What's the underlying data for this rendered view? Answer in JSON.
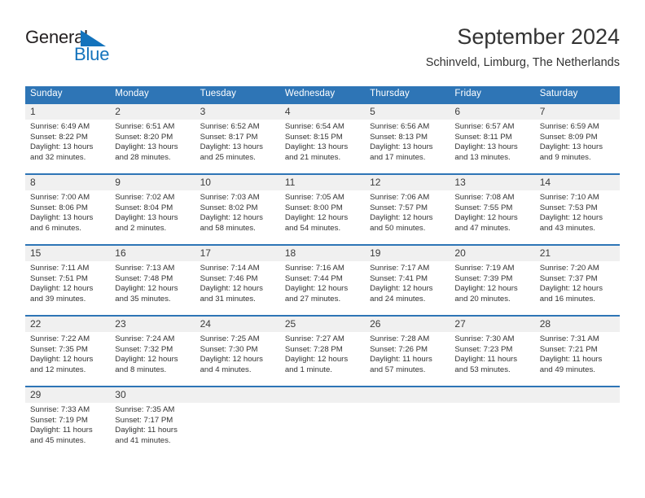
{
  "brand": {
    "name_part1": "General",
    "name_part2": "Blue",
    "triangle_color": "#1473bc",
    "text_color": "#231f20"
  },
  "header": {
    "title": "September 2024",
    "subtitle": "Schinveld, Limburg, The Netherlands"
  },
  "theme": {
    "header_bg": "#2e75b6",
    "header_text": "#ffffff",
    "daynum_bg": "#f0f0f0",
    "body_text": "#333333"
  },
  "weekdays": [
    {
      "label": "Sunday"
    },
    {
      "label": "Monday"
    },
    {
      "label": "Tuesday"
    },
    {
      "label": "Wednesday"
    },
    {
      "label": "Thursday"
    },
    {
      "label": "Friday"
    },
    {
      "label": "Saturday"
    }
  ],
  "weeks": [
    {
      "days": [
        {
          "num": "1",
          "sunrise": "Sunrise: 6:49 AM",
          "sunset": "Sunset: 8:22 PM",
          "daylight1": "Daylight: 13 hours",
          "daylight2": "and 32 minutes."
        },
        {
          "num": "2",
          "sunrise": "Sunrise: 6:51 AM",
          "sunset": "Sunset: 8:20 PM",
          "daylight1": "Daylight: 13 hours",
          "daylight2": "and 28 minutes."
        },
        {
          "num": "3",
          "sunrise": "Sunrise: 6:52 AM",
          "sunset": "Sunset: 8:17 PM",
          "daylight1": "Daylight: 13 hours",
          "daylight2": "and 25 minutes."
        },
        {
          "num": "4",
          "sunrise": "Sunrise: 6:54 AM",
          "sunset": "Sunset: 8:15 PM",
          "daylight1": "Daylight: 13 hours",
          "daylight2": "and 21 minutes."
        },
        {
          "num": "5",
          "sunrise": "Sunrise: 6:56 AM",
          "sunset": "Sunset: 8:13 PM",
          "daylight1": "Daylight: 13 hours",
          "daylight2": "and 17 minutes."
        },
        {
          "num": "6",
          "sunrise": "Sunrise: 6:57 AM",
          "sunset": "Sunset: 8:11 PM",
          "daylight1": "Daylight: 13 hours",
          "daylight2": "and 13 minutes."
        },
        {
          "num": "7",
          "sunrise": "Sunrise: 6:59 AM",
          "sunset": "Sunset: 8:09 PM",
          "daylight1": "Daylight: 13 hours",
          "daylight2": "and 9 minutes."
        }
      ]
    },
    {
      "days": [
        {
          "num": "8",
          "sunrise": "Sunrise: 7:00 AM",
          "sunset": "Sunset: 8:06 PM",
          "daylight1": "Daylight: 13 hours",
          "daylight2": "and 6 minutes."
        },
        {
          "num": "9",
          "sunrise": "Sunrise: 7:02 AM",
          "sunset": "Sunset: 8:04 PM",
          "daylight1": "Daylight: 13 hours",
          "daylight2": "and 2 minutes."
        },
        {
          "num": "10",
          "sunrise": "Sunrise: 7:03 AM",
          "sunset": "Sunset: 8:02 PM",
          "daylight1": "Daylight: 12 hours",
          "daylight2": "and 58 minutes."
        },
        {
          "num": "11",
          "sunrise": "Sunrise: 7:05 AM",
          "sunset": "Sunset: 8:00 PM",
          "daylight1": "Daylight: 12 hours",
          "daylight2": "and 54 minutes."
        },
        {
          "num": "12",
          "sunrise": "Sunrise: 7:06 AM",
          "sunset": "Sunset: 7:57 PM",
          "daylight1": "Daylight: 12 hours",
          "daylight2": "and 50 minutes."
        },
        {
          "num": "13",
          "sunrise": "Sunrise: 7:08 AM",
          "sunset": "Sunset: 7:55 PM",
          "daylight1": "Daylight: 12 hours",
          "daylight2": "and 47 minutes."
        },
        {
          "num": "14",
          "sunrise": "Sunrise: 7:10 AM",
          "sunset": "Sunset: 7:53 PM",
          "daylight1": "Daylight: 12 hours",
          "daylight2": "and 43 minutes."
        }
      ]
    },
    {
      "days": [
        {
          "num": "15",
          "sunrise": "Sunrise: 7:11 AM",
          "sunset": "Sunset: 7:51 PM",
          "daylight1": "Daylight: 12 hours",
          "daylight2": "and 39 minutes."
        },
        {
          "num": "16",
          "sunrise": "Sunrise: 7:13 AM",
          "sunset": "Sunset: 7:48 PM",
          "daylight1": "Daylight: 12 hours",
          "daylight2": "and 35 minutes."
        },
        {
          "num": "17",
          "sunrise": "Sunrise: 7:14 AM",
          "sunset": "Sunset: 7:46 PM",
          "daylight1": "Daylight: 12 hours",
          "daylight2": "and 31 minutes."
        },
        {
          "num": "18",
          "sunrise": "Sunrise: 7:16 AM",
          "sunset": "Sunset: 7:44 PM",
          "daylight1": "Daylight: 12 hours",
          "daylight2": "and 27 minutes."
        },
        {
          "num": "19",
          "sunrise": "Sunrise: 7:17 AM",
          "sunset": "Sunset: 7:41 PM",
          "daylight1": "Daylight: 12 hours",
          "daylight2": "and 24 minutes."
        },
        {
          "num": "20",
          "sunrise": "Sunrise: 7:19 AM",
          "sunset": "Sunset: 7:39 PM",
          "daylight1": "Daylight: 12 hours",
          "daylight2": "and 20 minutes."
        },
        {
          "num": "21",
          "sunrise": "Sunrise: 7:20 AM",
          "sunset": "Sunset: 7:37 PM",
          "daylight1": "Daylight: 12 hours",
          "daylight2": "and 16 minutes."
        }
      ]
    },
    {
      "days": [
        {
          "num": "22",
          "sunrise": "Sunrise: 7:22 AM",
          "sunset": "Sunset: 7:35 PM",
          "daylight1": "Daylight: 12 hours",
          "daylight2": "and 12 minutes."
        },
        {
          "num": "23",
          "sunrise": "Sunrise: 7:24 AM",
          "sunset": "Sunset: 7:32 PM",
          "daylight1": "Daylight: 12 hours",
          "daylight2": "and 8 minutes."
        },
        {
          "num": "24",
          "sunrise": "Sunrise: 7:25 AM",
          "sunset": "Sunset: 7:30 PM",
          "daylight1": "Daylight: 12 hours",
          "daylight2": "and 4 minutes."
        },
        {
          "num": "25",
          "sunrise": "Sunrise: 7:27 AM",
          "sunset": "Sunset: 7:28 PM",
          "daylight1": "Daylight: 12 hours",
          "daylight2": "and 1 minute."
        },
        {
          "num": "26",
          "sunrise": "Sunrise: 7:28 AM",
          "sunset": "Sunset: 7:26 PM",
          "daylight1": "Daylight: 11 hours",
          "daylight2": "and 57 minutes."
        },
        {
          "num": "27",
          "sunrise": "Sunrise: 7:30 AM",
          "sunset": "Sunset: 7:23 PM",
          "daylight1": "Daylight: 11 hours",
          "daylight2": "and 53 minutes."
        },
        {
          "num": "28",
          "sunrise": "Sunrise: 7:31 AM",
          "sunset": "Sunset: 7:21 PM",
          "daylight1": "Daylight: 11 hours",
          "daylight2": "and 49 minutes."
        }
      ]
    },
    {
      "days": [
        {
          "num": "29",
          "sunrise": "Sunrise: 7:33 AM",
          "sunset": "Sunset: 7:19 PM",
          "daylight1": "Daylight: 11 hours",
          "daylight2": "and 45 minutes."
        },
        {
          "num": "30",
          "sunrise": "Sunrise: 7:35 AM",
          "sunset": "Sunset: 7:17 PM",
          "daylight1": "Daylight: 11 hours",
          "daylight2": "and 41 minutes."
        },
        {
          "num": "",
          "sunrise": "",
          "sunset": "",
          "daylight1": "",
          "daylight2": ""
        },
        {
          "num": "",
          "sunrise": "",
          "sunset": "",
          "daylight1": "",
          "daylight2": ""
        },
        {
          "num": "",
          "sunrise": "",
          "sunset": "",
          "daylight1": "",
          "daylight2": ""
        },
        {
          "num": "",
          "sunrise": "",
          "sunset": "",
          "daylight1": "",
          "daylight2": ""
        },
        {
          "num": "",
          "sunrise": "",
          "sunset": "",
          "daylight1": "",
          "daylight2": ""
        }
      ]
    }
  ]
}
